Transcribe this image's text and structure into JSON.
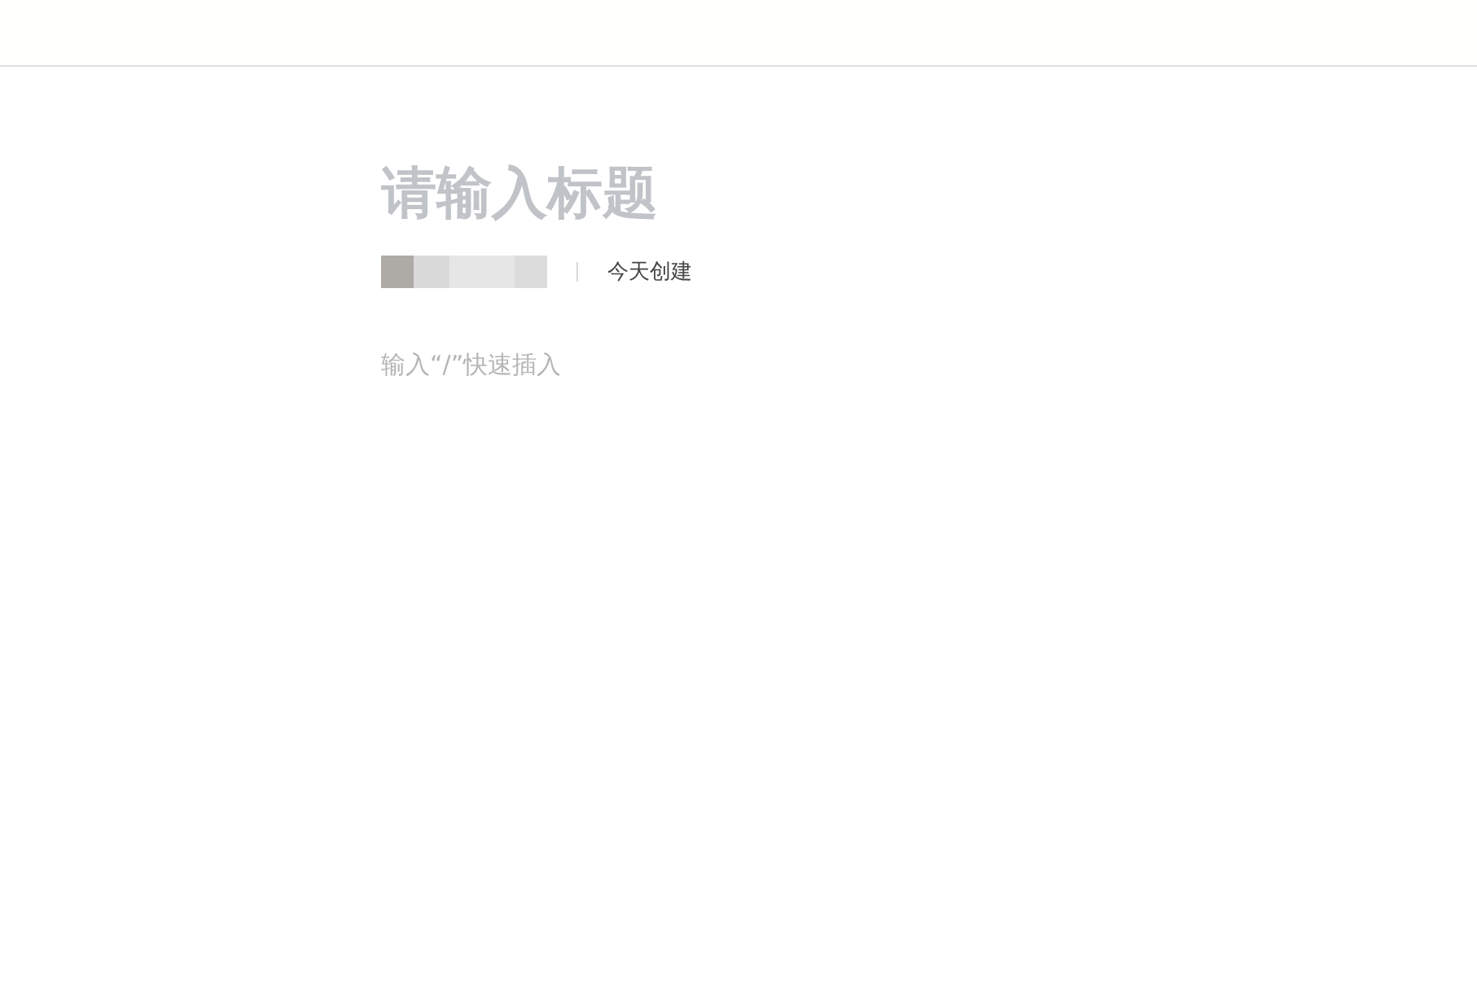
{
  "title_field": {
    "placeholder": "请输入标题"
  },
  "meta": {
    "created": "今天创建"
  },
  "body_field": {
    "placeholder": "输入“/”快速插入"
  }
}
